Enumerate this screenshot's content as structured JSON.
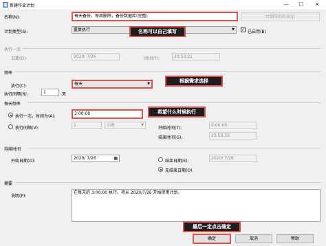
{
  "window": {
    "title": "新建作业计划",
    "min": "—",
    "max": "☐",
    "close": "✕"
  },
  "name_row": {
    "label": "名称(N):",
    "value": "每天备份，每周删除，备份数据库(完整)",
    "jobs_button": "计划中的作业(J)"
  },
  "type_row": {
    "label": "计划类型(S):",
    "value": "重复执行",
    "enabled_label": "已启用(B)",
    "enabled": true
  },
  "once": {
    "section": "执行一次",
    "date_label": "日期(D):",
    "date": "2020/ 7/26",
    "time_label": "时间(T):",
    "time": "20:53:21"
  },
  "frequency": {
    "section": "频率",
    "occurs_label": "执行(C):",
    "occurs": "每天",
    "interval_label": "执行间隔(R):",
    "interval": "1",
    "interval_unit": "天"
  },
  "daily": {
    "section": "每天频率",
    "once_at_label": "执行一次，时间为(A):",
    "once_at": "3:00:00",
    "every_label": "执行间隔(V):",
    "every": "1",
    "every_unit": "小时",
    "start_label": "开始时间(T):",
    "start": "0:00:00",
    "end_label": "结束时间(G):",
    "end": "23:59:59"
  },
  "duration": {
    "section": "持续时间",
    "start_label": "开始日期(D):",
    "start": "2020/ 7/26",
    "end_label": "结束日期(E):",
    "end": "2020/ 7/26",
    "no_end_label": "无结束日期(O)"
  },
  "summary": {
    "section": "摘要",
    "label": "说明(P):",
    "text": "在每天的 3:00:00 执行。将从 2020/7/26 开始使用计划。"
  },
  "buttons": {
    "ok": "确定",
    "cancel": "取消",
    "help": "帮助"
  },
  "annotations": {
    "name_note": "名称可以自己填写",
    "need_note": "根据需求选择",
    "time_note": "希望什么时候执行",
    "ok_note": "最后一定点击确定"
  },
  "colors": {
    "callout_bg": "#1e1e1e",
    "callout_border": "#d9534f",
    "highlight": "#d9534f"
  }
}
